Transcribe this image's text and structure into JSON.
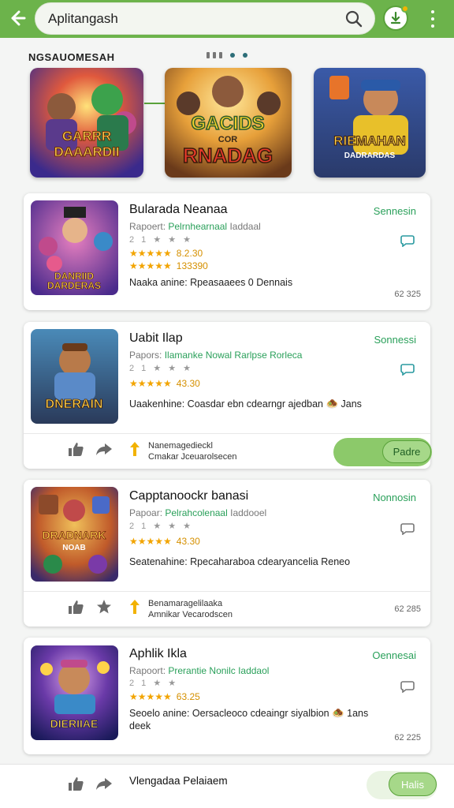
{
  "header": {
    "search_text": "Aplitangash",
    "icons": {
      "back": "back-arrow-icon",
      "search": "search-icon",
      "download": "download-icon",
      "menu": "more-vert-icon"
    }
  },
  "featured": {
    "title": "NGSAUOMESAH",
    "banners": [
      {
        "art": "GARRR DAAARDII"
      },
      {
        "art": "GACIDS COR RNADAG"
      },
      {
        "art": "RIEMAHAN DADRARDAS"
      }
    ]
  },
  "cards": [
    {
      "title": "Bularada Neanaa",
      "meta_prefix": "Rapoert:",
      "developer": "Pelrnhearnaal",
      "meta_suffix": "Iaddaal",
      "rating_stars": "2 1 ★ ★ ★",
      "stars": "★★★★★",
      "rating_text": "8.2.30",
      "rating_text2": "133390",
      "description": "Naaka anine: Rpeasaaees 0 Dennais",
      "status": "Sennesin",
      "count": "62 325",
      "art": "DANRIID DARDERAS"
    },
    {
      "title": "Uabit Ilap",
      "meta_prefix": "Papors:",
      "developer": "Ilamanke Nowal Rarlpse Rorleca",
      "rating_stars": "2 1 ★ ★ ★",
      "stars": "★★★★★",
      "rating_text": "43.30",
      "description": "Uaakenhine: Coasdar ebn cdearngr ajedban 🧆 Jans",
      "status": "Sonnessi",
      "action_text_line1": "Nanemagedieckl",
      "action_text_line2": "Cmakar Jceuarolsecen",
      "button": "Padre",
      "art": "DNERAIN"
    },
    {
      "title": "Capptanoockr banasi",
      "meta_prefix": "Papoar:",
      "developer": "Pelrahcolenaal",
      "meta_suffix": "Iaddooel",
      "rating_stars": "2 1 ★ ★ ★",
      "stars": "★★★★★",
      "rating_text": "43.30",
      "description": "Seatenahine: Rpecaharaboa cdearyancelia Reneo",
      "status": "Nonnosin",
      "action_text_line1": "Benamaragelilaaka",
      "action_text_line2": "Amnikar Vecarodscen",
      "count": "62 285",
      "art": "DRADNARK NOAB"
    },
    {
      "title": "Aphlik Ikla",
      "meta_prefix": "Rapoort:",
      "developer": "Prerantie Nonilc Iaddaol",
      "rating_stars": "2 1 ★ ★",
      "stars": "★★★★★",
      "rating_text": "63.25",
      "description": "Seoelo anine: Oersacleoco cdeaingr siyalbion 🧆 1ans",
      "description_line2": "deek",
      "status": "Oennesai",
      "count": "62 225",
      "art": "DIERIIAE"
    }
  ],
  "bottom_bar": {
    "label": "Vlengadaa Pelaiaem",
    "button": "Halis"
  },
  "colors": {
    "brand_green": "#6cb34b",
    "status_green": "#2aa05a",
    "star": "#f2a400"
  }
}
